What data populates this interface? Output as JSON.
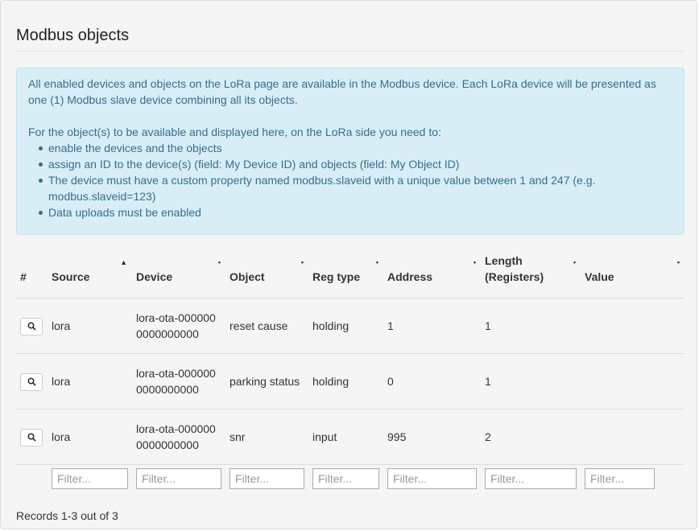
{
  "title": "Modbus objects",
  "info": {
    "para1": "All enabled devices and objects on the LoRa page are available in the Modbus device. Each LoRa device will be presented as one (1) Modbus slave device combining all its objects.",
    "para2": "For the object(s) to be available and displayed here, on the LoRa side you need to:",
    "bullets": [
      "enable the devices and the objects",
      "assign an ID to the device(s) (field: My Device ID) and objects (field: My Object ID)",
      "The device must have a custom property named modbus.slaveid with a unique value between 1 and 247 (e.g. modbus.slaveid=123)",
      "Data uploads must be enabled"
    ]
  },
  "table": {
    "headers": {
      "num": "#",
      "source": "Source",
      "device": "Device",
      "object": "Object",
      "regtype": "Reg type",
      "address": "Address",
      "length": "Length (Registers)",
      "value": "Value"
    },
    "sort_markers": {
      "source": "▲",
      "device": "•",
      "object": "•",
      "regtype": "•",
      "address": "•",
      "length": "•",
      "value": "•"
    },
    "rows": [
      {
        "source": "lora",
        "device": "lora-ota-0000000000000000",
        "object": "reset cause",
        "regtype": "holding",
        "address": "1",
        "length": "1",
        "value": ""
      },
      {
        "source": "lora",
        "device": "lora-ota-0000000000000000",
        "object": "parking status",
        "regtype": "holding",
        "address": "0",
        "length": "1",
        "value": ""
      },
      {
        "source": "lora",
        "device": "lora-ota-0000000000000000",
        "object": "snr",
        "regtype": "input",
        "address": "995",
        "length": "2",
        "value": ""
      }
    ],
    "view_icon": "magnifier-icon",
    "filter_placeholder": "Filter..."
  },
  "records": "Records 1-3 out of 3",
  "colors": {
    "info_bg": "#d9edf7",
    "info_text": "#31708f",
    "panel_bg": "#f5f5f5"
  }
}
